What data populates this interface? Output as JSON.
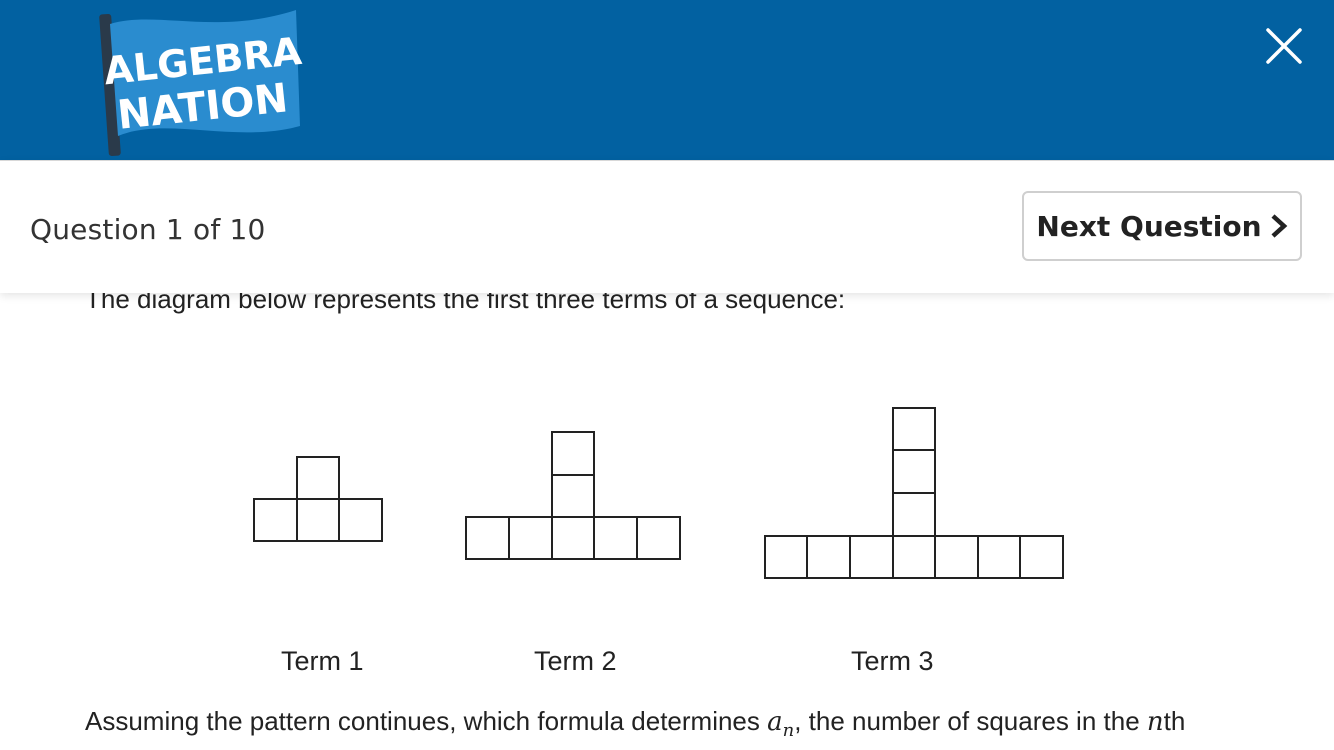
{
  "app": {
    "logo_line1": "ALGEBRA",
    "logo_line2": "NATION",
    "header_color": "#0261a1"
  },
  "quiz": {
    "counter": "Question 1 of 10",
    "next_label": "Next Question"
  },
  "question": {
    "intro": "The diagram below represents the first three terms of a sequence:",
    "terms": [
      {
        "label": "Term 1",
        "squares": 4
      },
      {
        "label": "Term 2",
        "squares": 7
      },
      {
        "label": "Term 3",
        "squares": 10
      }
    ],
    "prompt_before": "Assuming the pattern continues, which formula determines ",
    "prompt_var": "a",
    "prompt_sub": "n",
    "prompt_middle": ", the number of squares in the ",
    "prompt_n": "n",
    "prompt_end": "th"
  },
  "icons": {
    "close": "close-icon",
    "next": "chevron-right-icon"
  }
}
